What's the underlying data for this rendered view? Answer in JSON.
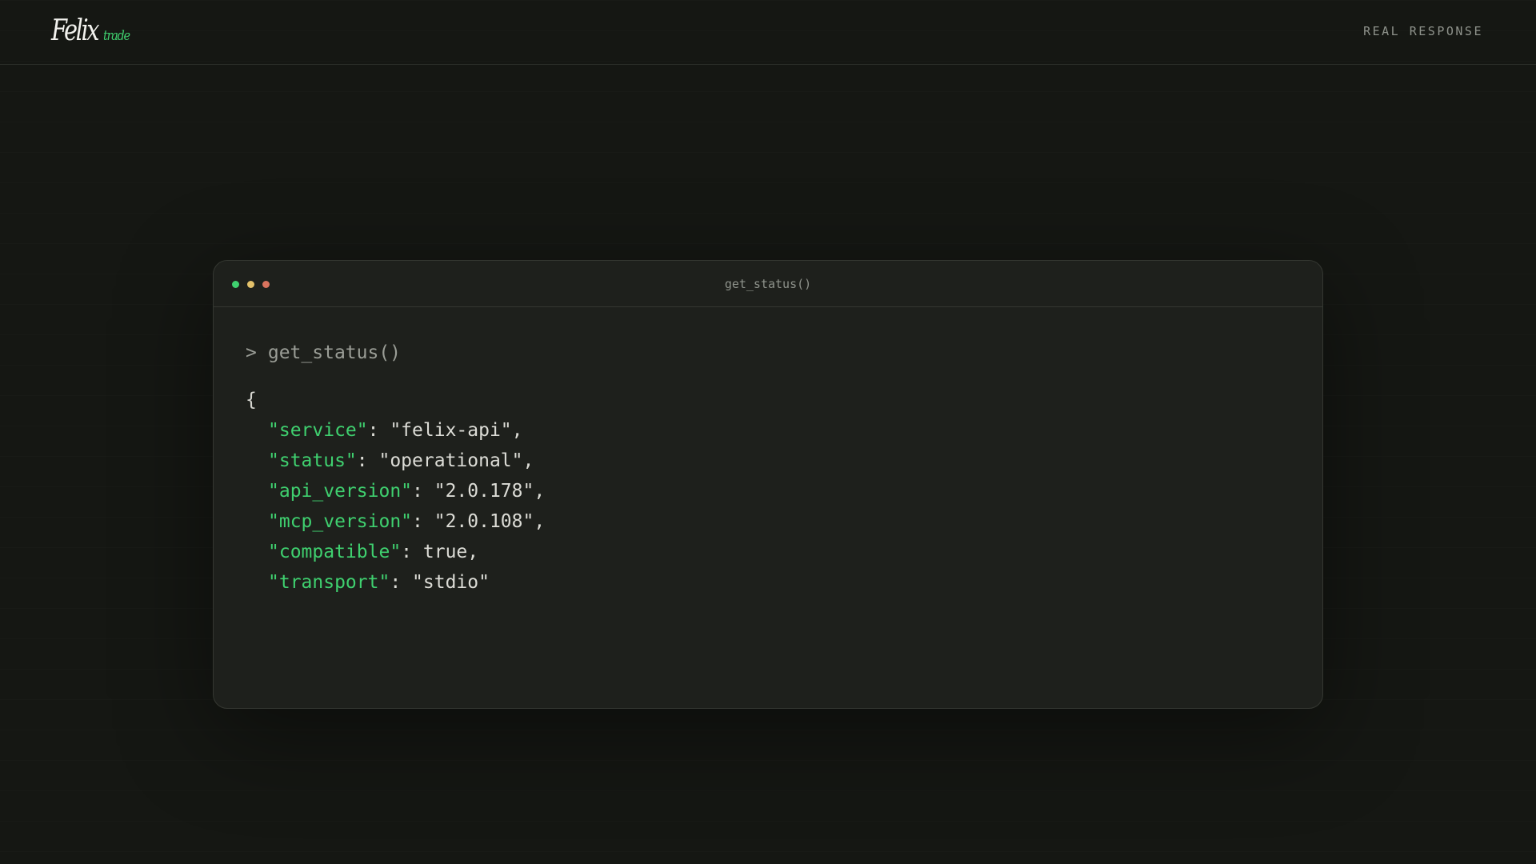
{
  "header": {
    "logo_main": "Felix",
    "logo_sub": "trade",
    "label": "REAL RESPONSE"
  },
  "terminal": {
    "title": "get_status()",
    "window_dots": [
      {
        "name": "green-dot",
        "color": "#3fd06f"
      },
      {
        "name": "yellow-dot",
        "color": "#e3c16a"
      },
      {
        "name": "red-dot",
        "color": "#d9735e"
      }
    ],
    "prompt_symbol": ">",
    "command": "get_status()",
    "open_brace": "{",
    "lines": [
      {
        "key": "\"service\"",
        "sep": ": ",
        "value": "\"felix-api\","
      },
      {
        "key": "\"status\"",
        "sep": ": ",
        "value": "\"operational\","
      },
      {
        "key": "\"api_version\"",
        "sep": ": ",
        "value": "\"2.0.178\","
      },
      {
        "key": "\"mcp_version\"",
        "sep": ": ",
        "value": "\"2.0.108\","
      },
      {
        "key": "\"compatible\"",
        "sep": ": ",
        "value": "true,"
      },
      {
        "key": "\"transport\"",
        "sep": ": ",
        "value": "\"stdio\""
      }
    ]
  },
  "colors": {
    "background": "#151713",
    "panel": "#1e201c",
    "accent": "#3fd06f",
    "muted": "#8e928b"
  }
}
